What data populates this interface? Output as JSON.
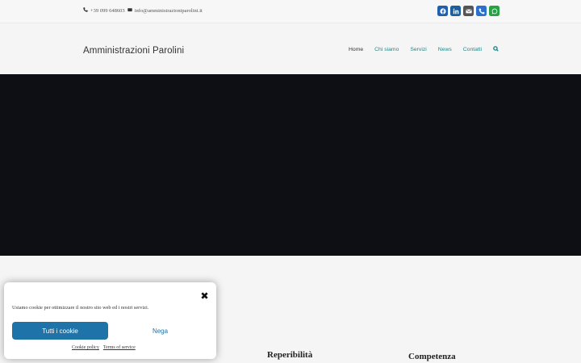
{
  "topbar": {
    "phone": "+39 099 648603",
    "email": "info@amministrazioniparolini.it",
    "socials": [
      {
        "icon": "facebook-icon",
        "color": "#1f5fae"
      },
      {
        "icon": "linkedin-icon",
        "color": "#1d5f9e"
      },
      {
        "icon": "mail-icon",
        "color": "#555555"
      },
      {
        "icon": "phone-icon",
        "color": "#2b6fcf"
      },
      {
        "icon": "whatsapp-icon",
        "color": "#25a244"
      }
    ]
  },
  "header": {
    "brand": "Amministrazioni Parolini",
    "nav": {
      "home": "Home",
      "chi_siamo": "Chi siamo",
      "servizi": "Servizi",
      "news": "News",
      "contatti": "Contatti"
    }
  },
  "content": {
    "col2_title": "Reperibilità",
    "col3_title": "Competenza"
  },
  "cookie": {
    "message": "Usiamo cookie per ottimizzare il nostro sito web ed i nostri servizi.",
    "accept_label": "Tutti i cookie",
    "deny_label": "Nega",
    "policy_label": "Cookie policy",
    "terms_label": "Terms of service"
  },
  "colors": {
    "accent": "#1e8a8a",
    "button": "#1e73a8",
    "hero": "#0d0f14"
  }
}
